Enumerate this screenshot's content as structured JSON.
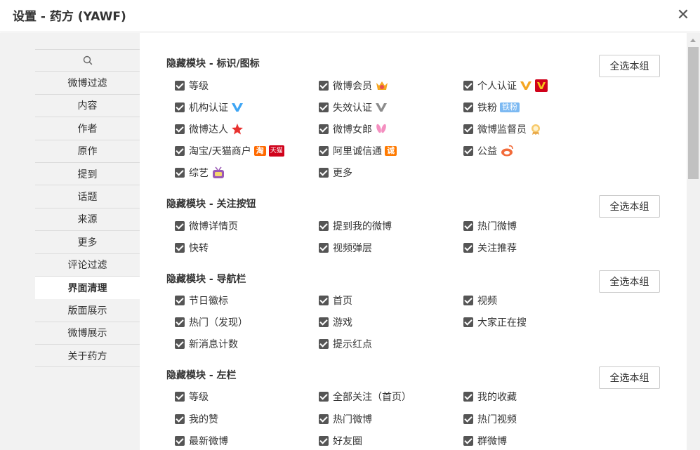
{
  "title": "设置 - 药方 (YAWF)",
  "sidebar": {
    "items": [
      {
        "label": "微博过滤"
      },
      {
        "label": "内容"
      },
      {
        "label": "作者"
      },
      {
        "label": "原作"
      },
      {
        "label": "提到"
      },
      {
        "label": "话题"
      },
      {
        "label": "来源"
      },
      {
        "label": "更多"
      },
      {
        "label": "评论过滤"
      },
      {
        "label": "界面清理"
      },
      {
        "label": "版面展示"
      },
      {
        "label": "微博展示"
      },
      {
        "label": "关于药方"
      }
    ]
  },
  "select_all_label": "全选本组",
  "groups": [
    {
      "title": "隐藏模块 - 标识/图标",
      "options": [
        "等级",
        "微博会员",
        "个人认证",
        "机构认证",
        "失效认证",
        "铁粉",
        "微博达人",
        "微博女郎",
        "微博监督员",
        "淘宝/天猫商户",
        "阿里诚信通",
        "公益",
        "综艺",
        "更多"
      ]
    },
    {
      "title": "隐藏模块 - 关注按钮",
      "options": [
        "微博详情页",
        "提到我的微博",
        "热门微博",
        "快转",
        "视频弹层",
        "关注推荐"
      ]
    },
    {
      "title": "隐藏模块 - 导航栏",
      "options": [
        "节日徽标",
        "首页",
        "视频",
        "热门（发现）",
        "游戏",
        "大家正在搜",
        "新消息计数",
        "提示红点"
      ]
    },
    {
      "title": "隐藏模块 - 左栏",
      "options": [
        "等级",
        "全部关注（首页）",
        "我的收藏",
        "我的赞",
        "热门微博",
        "热门视频",
        "最新微博",
        "好友圈",
        "群微博"
      ]
    }
  ],
  "badges": {
    "tiefen": "铁粉",
    "tianmao": "天猫",
    "tao": "淘",
    "cheng": "诚"
  },
  "colors": {
    "checkbox": "#555555",
    "sidebar_bg": "#f2f2f2",
    "active_item_bg": "#ffffff",
    "verify_orange": "#f5a623",
    "verify_blue": "#3ea5f4",
    "verify_gray": "#8c8c8c",
    "taobao_orange": "#ff6a00",
    "tmall_red": "#d0021b"
  }
}
